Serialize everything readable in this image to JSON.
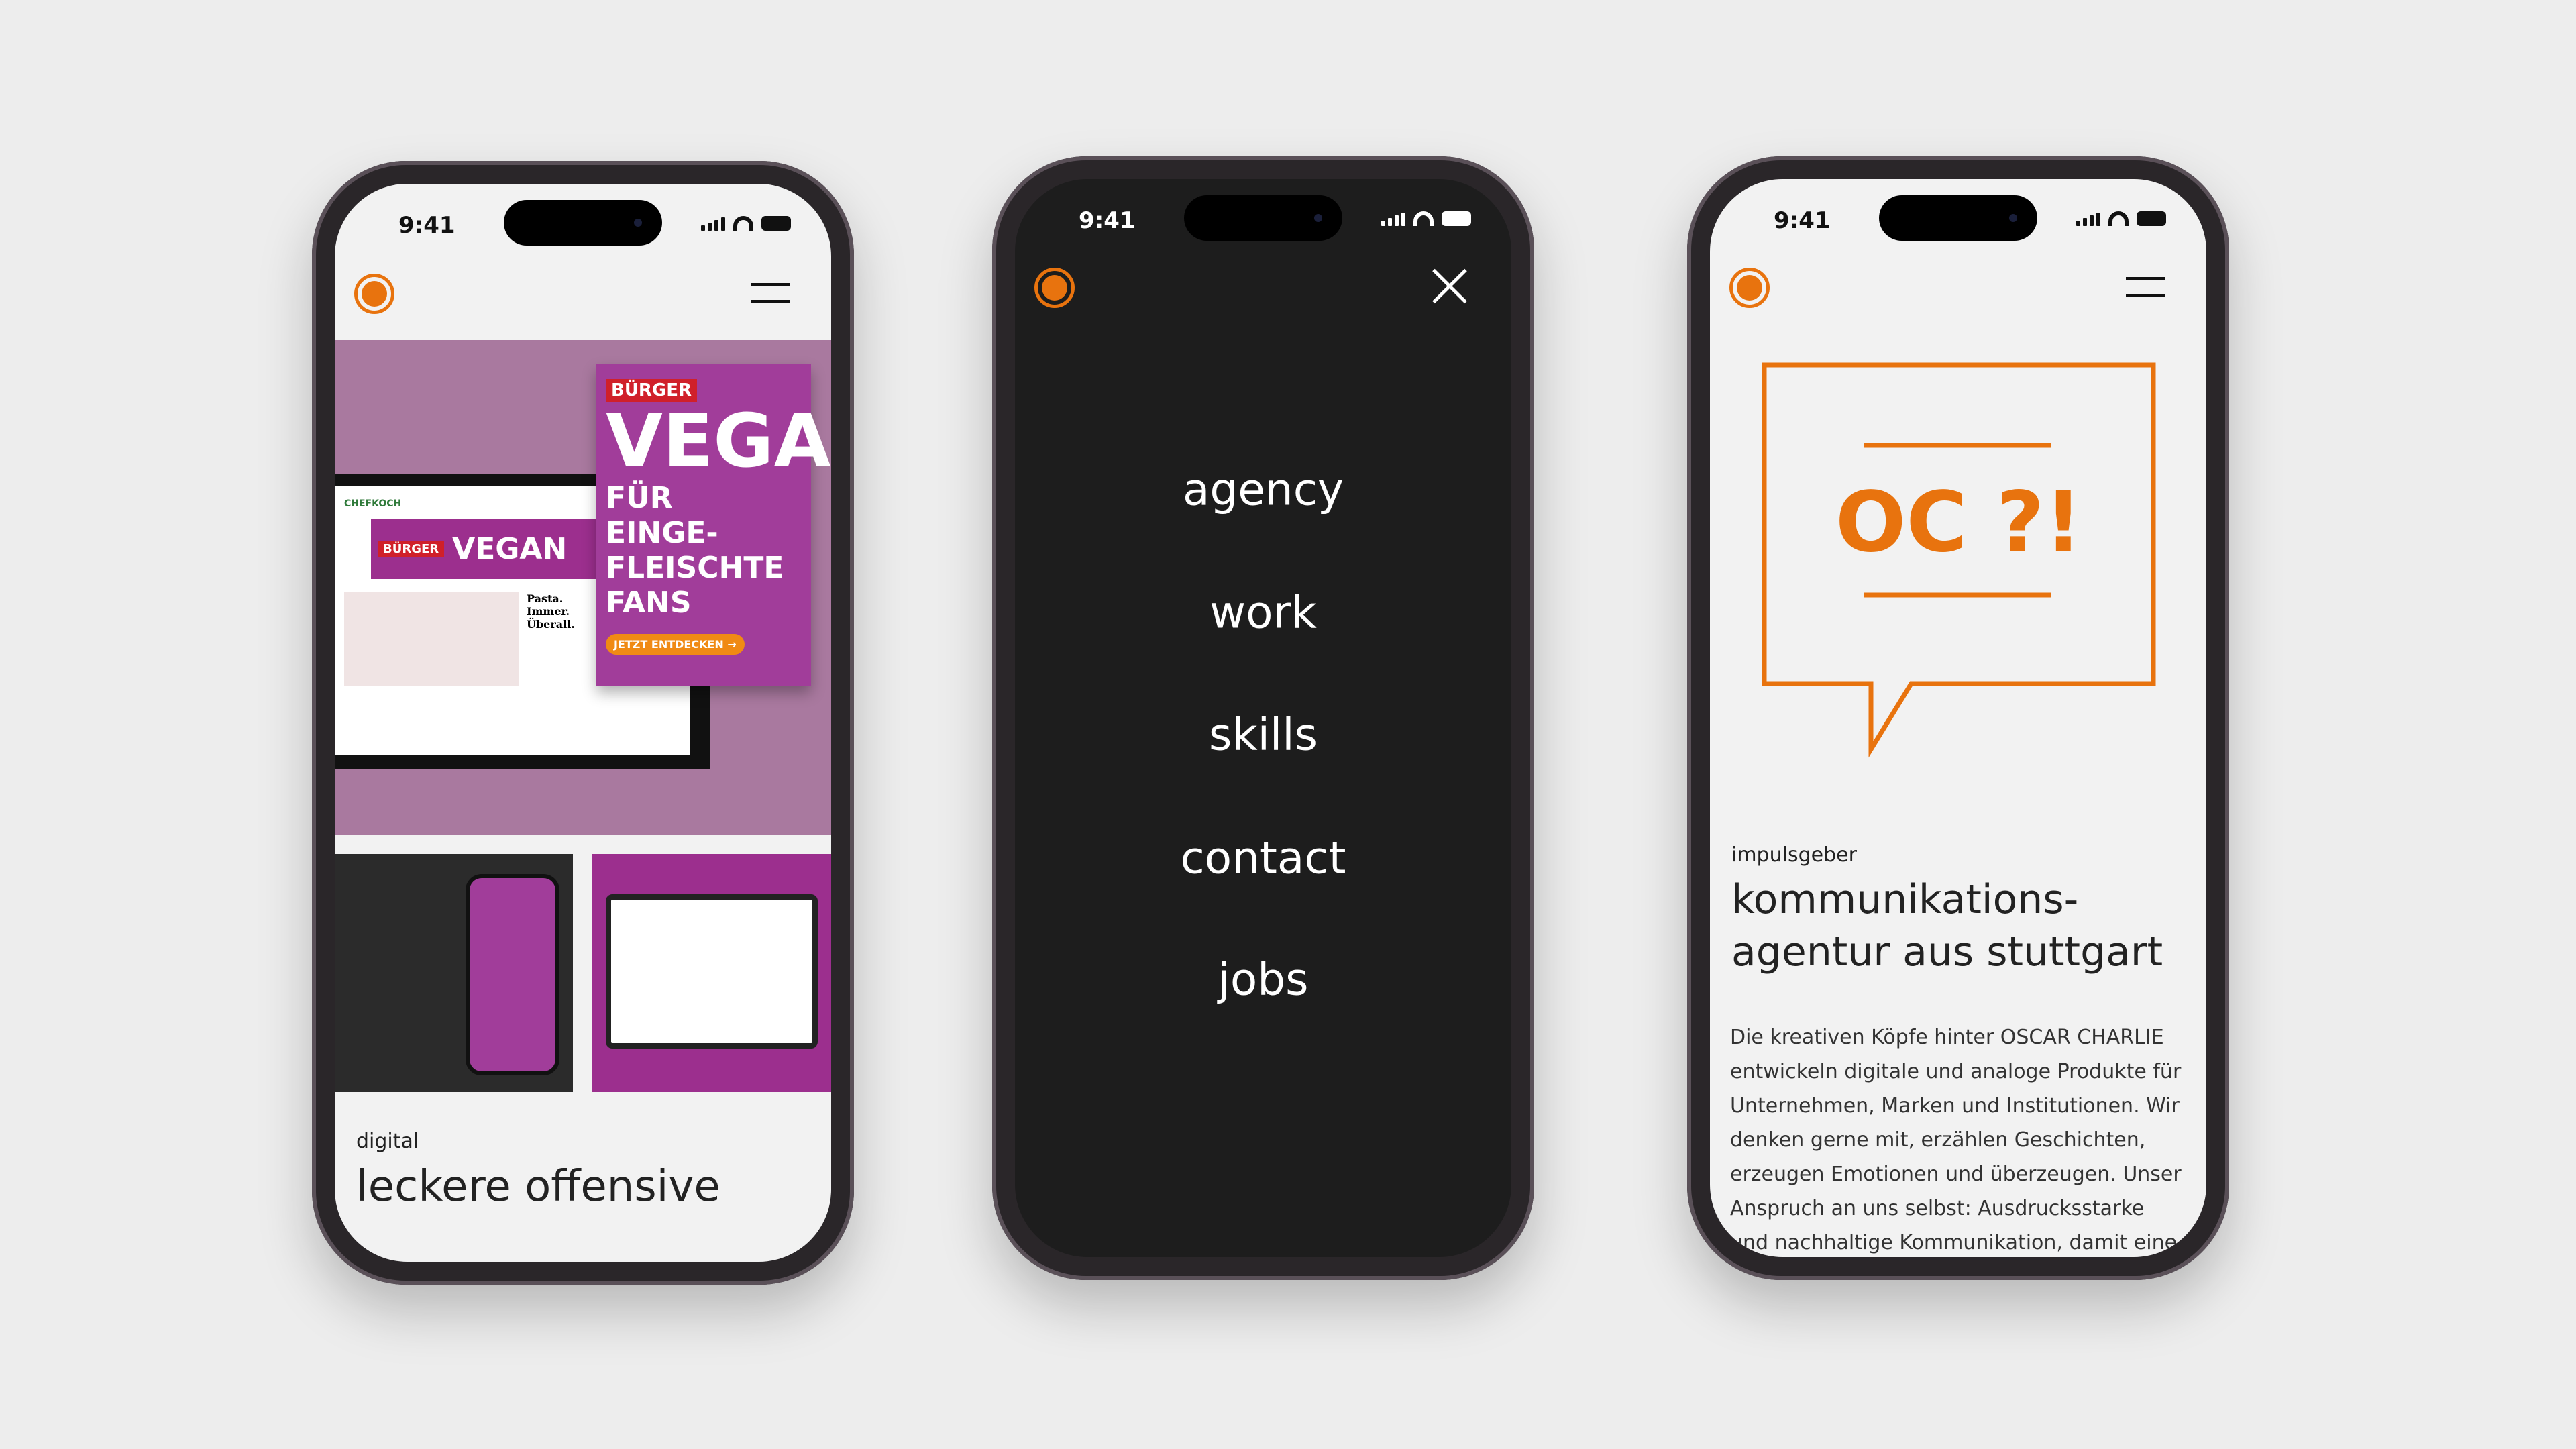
{
  "status_time": "9:41",
  "brand_color": "#e8730e",
  "phone1": {
    "image": {
      "site": "CHEFKOCH",
      "brand": "BÜRGER",
      "headline": "VEGAN",
      "tagline": "FÜR EINGE-FLEISCHTE FANS",
      "cta": "JETZT ENTDECKEN →",
      "article": "Pasta. Immer. Überall."
    },
    "category": "digital",
    "title": "leckere offensive"
  },
  "phone2": {
    "menu": [
      "agency",
      "work",
      "skills",
      "contact",
      "jobs"
    ]
  },
  "phone3": {
    "logo_bubble_text": "OC ?!",
    "category": "impulsgeber",
    "title_lines": [
      "kommunikations-",
      "agentur aus stuttgart"
    ],
    "body": "Die kreativen Köpfe hinter OSCAR CHARLIE entwickeln digitale und analoge Produkte für Unternehmen, Marken und Institutionen. Wir denken gerne mit, erzählen Geschichten, erzeugen Emotionen und überzeugen. Unser Anspruch an uns selbst: Ausdrucksstarke und nachhaltige Kommunikation, damit eine Marke"
  }
}
